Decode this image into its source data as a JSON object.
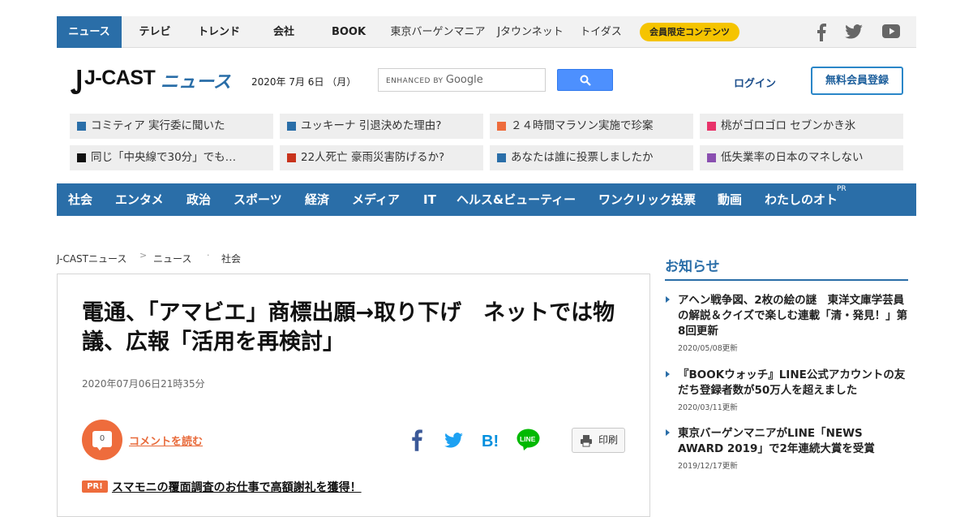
{
  "top_nav": {
    "items": [
      "ニュース",
      "テレビ",
      "トレンド",
      "会社",
      "BOOK",
      "東京バーゲンマニア",
      "Jタウンネット",
      "トイダス"
    ],
    "member_label": "会員限定コンテンツ",
    "icons": [
      "facebook-icon",
      "twitter-icon",
      "youtube-icon"
    ]
  },
  "header": {
    "logo_main": "J-CAST",
    "logo_sub": "ニュース",
    "date": "2020年 7月 6日 （月）",
    "search_placeholder_prefix": "ENHANCED BY",
    "search_placeholder_brand": "Google",
    "login_label": "ログイン",
    "signup_label": "無料会員登録"
  },
  "trending": [
    {
      "label": "コミティア 実行委に聞いた",
      "color": "#2a6ea8"
    },
    {
      "label": "ユッキーナ 引退決めた理由?",
      "color": "#2a6ea8"
    },
    {
      "label": "２４時間マラソン実施で珍案",
      "color": "#ee6c3c"
    },
    {
      "label": "桃がゴロゴロ セブンかき氷",
      "color": "#e8336a"
    },
    {
      "label": "同じ「中央線で30分」でも…",
      "color": "#111111"
    },
    {
      "label": "22人死亡 豪雨災害防げるか?",
      "color": "#c8331c"
    },
    {
      "label": "あなたは誰に投票しましたか",
      "color": "#2a6ea8"
    },
    {
      "label": "低失業率の日本のマネしない",
      "color": "#8a4fb0"
    }
  ],
  "categories": [
    "社会",
    "エンタメ",
    "政治",
    "スポーツ",
    "経済",
    "メディア",
    "IT",
    "ヘルス&ビューティー",
    "ワンクリック投票",
    "動画",
    "わたしのオト"
  ],
  "category_pr": "PR",
  "breadcrumb": [
    "J-CASTニュース",
    "ニュース",
    "社会"
  ],
  "article": {
    "headline": "電通、「アマビエ」商標出願→取り下げ　ネットでは物議、広報「活用を再検討」",
    "published": "2020年07月06日21時35分",
    "comment_count": "0",
    "comment_link": "コメントを読む",
    "print_label": "印刷",
    "pr_badge": "PR!",
    "pr_link": "スマモニの覆面調査のお仕事で高額謝礼を獲得！"
  },
  "sidebar": {
    "title": "お知らせ",
    "items": [
      {
        "title": "アヘン戦争図、2枚の絵の謎　東洋文庫学芸員の解説＆クイズで楽しむ連載「清・発見！」第8回更新",
        "date": "2020/05/08更新"
      },
      {
        "title": "『BOOKウォッチ』LINE公式アカウントの友だち登録者数が50万人を超えました",
        "date": "2020/03/11更新"
      },
      {
        "title": "東京バーゲンマニアがLINE「NEWS AWARD 2019」で2年連続大賞を受賞",
        "date": "2019/12/17更新"
      }
    ]
  },
  "colors": {
    "brand_blue": "#2a6ea8",
    "accent_orange": "#ee6c3c",
    "member_yellow": "#f5c400"
  }
}
